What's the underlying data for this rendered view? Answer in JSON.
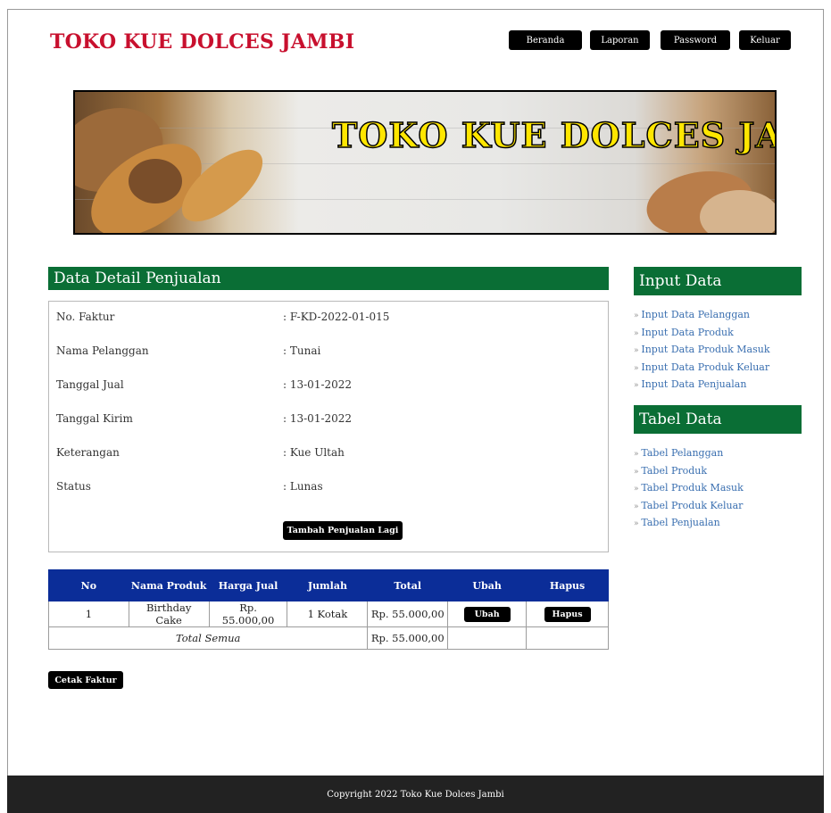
{
  "header": {
    "site_title": "TOKO KUE DOLCES JAMBI",
    "nav": [
      "Beranda",
      "Laporan",
      "Password",
      "Keluar"
    ]
  },
  "banner": {
    "text": "TOKO KUE DOLCES JAMBI"
  },
  "detail": {
    "title": "Data Detail Penjualan",
    "fields": [
      {
        "label": "No. Faktur",
        "value": ": F-KD-2022-01-015"
      },
      {
        "label": "Nama Pelanggan",
        "value": ": Tunai"
      },
      {
        "label": "Tanggal Jual",
        "value": ": 13-01-2022"
      },
      {
        "label": "Tanggal Kirim",
        "value": ": 13-01-2022"
      },
      {
        "label": "Keterangan",
        "value": ": Kue Ultah"
      },
      {
        "label": "Status",
        "value": ": Lunas"
      }
    ],
    "add_button": "Tambah Penjualan Lagi"
  },
  "table": {
    "headers": [
      "No",
      "Nama Produk",
      "Harga Jual",
      "Jumlah",
      "Total",
      "Ubah",
      "Hapus"
    ],
    "rows": [
      {
        "no": "1",
        "produk": "Birthday Cake",
        "harga": "Rp. 55.000,00",
        "jumlah": "1 Kotak",
        "total": "Rp. 55.000,00",
        "ubah": "Ubah",
        "hapus": "Hapus"
      }
    ],
    "total_label": "Total Semua",
    "total_value": "Rp. 55.000,00"
  },
  "print_button": "Cetak Faktur",
  "sidebar": {
    "input_title": "Input Data",
    "input_items": [
      "Input Data Pelanggan",
      "Input Data Produk",
      "Input Data Produk Masuk",
      "Input Data Produk Keluar",
      "Input Data Penjualan"
    ],
    "table_title": "Tabel Data",
    "table_items": [
      "Tabel Pelanggan",
      "Tabel Produk",
      "Tabel Produk Masuk",
      "Tabel Produk Keluar",
      "Tabel Penjualan"
    ]
  },
  "footer": {
    "text": "Copyright 2022 Toko Kue Dolces Jambi"
  },
  "colors": {
    "title_red": "#c8102e",
    "section_green": "#0a6e35",
    "table_header_blue": "#0b2d98",
    "link_blue": "#3a6fb0",
    "banner_text_yellow": "#ffe600"
  }
}
